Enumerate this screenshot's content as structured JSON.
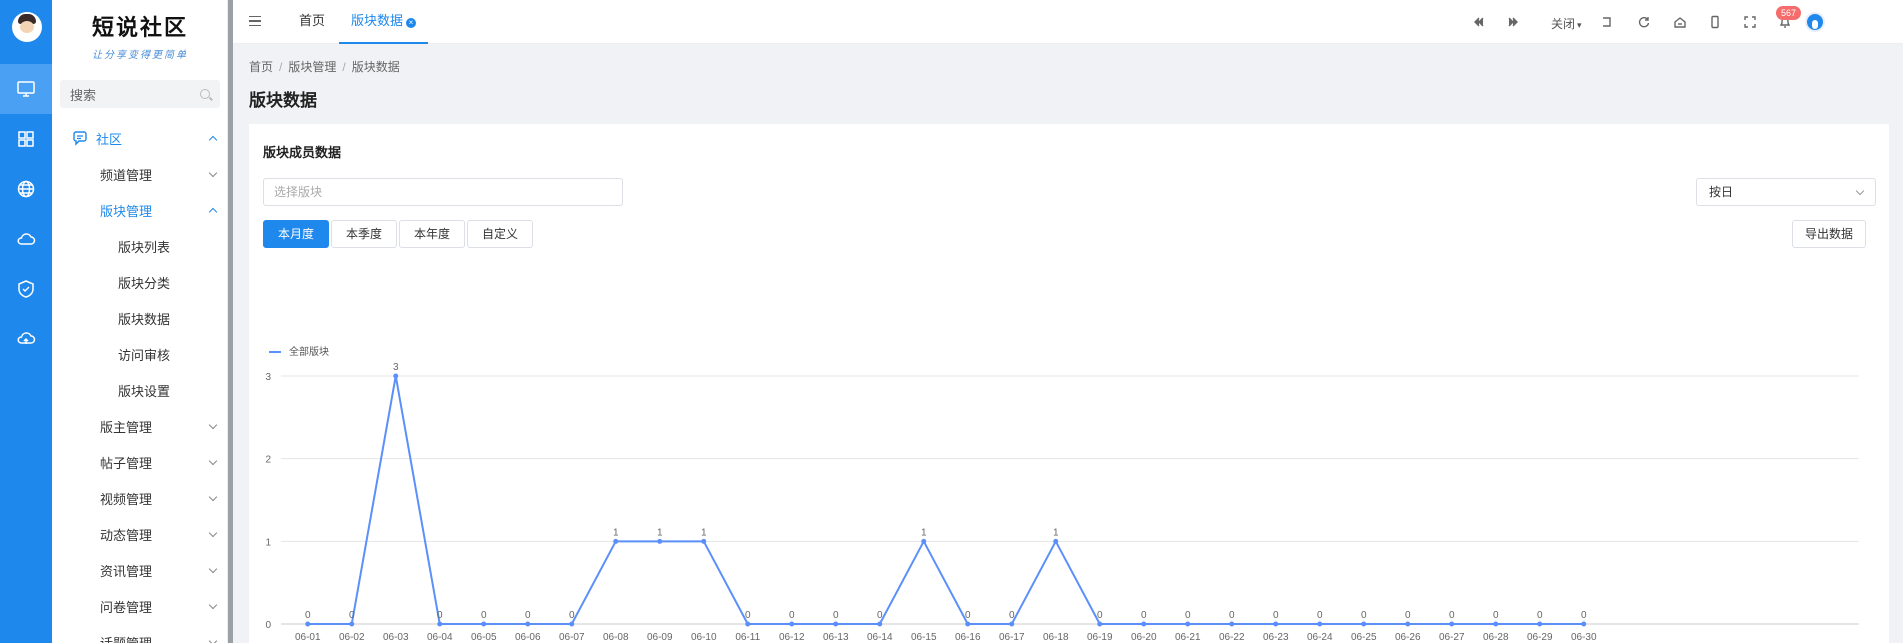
{
  "sidebar": {
    "logo_title": "短说社区",
    "logo_sub": "让分享变得更简单",
    "search_label": "搜索",
    "rail_icons": [
      "monitor-icon",
      "grid-icon",
      "globe-icon",
      "cloud-icon",
      "shield-icon",
      "cloud-home-icon"
    ],
    "menu": [
      {
        "label": "社区",
        "level": 1,
        "expanded": true
      },
      {
        "label": "频道管理",
        "level": 2
      },
      {
        "label": "版块管理",
        "level": 2,
        "expanded": true
      },
      {
        "label": "版块列表",
        "level": 3
      },
      {
        "label": "版块分类",
        "level": 3
      },
      {
        "label": "版块数据",
        "level": 3
      },
      {
        "label": "访问审核",
        "level": 3
      },
      {
        "label": "版块设置",
        "level": 3
      },
      {
        "label": "版主管理",
        "level": 2
      },
      {
        "label": "帖子管理",
        "level": 2
      },
      {
        "label": "视频管理",
        "level": 2
      },
      {
        "label": "动态管理",
        "level": 2
      },
      {
        "label": "资讯管理",
        "level": 2
      },
      {
        "label": "问卷管理",
        "level": 2
      },
      {
        "label": "话题管理",
        "level": 2
      }
    ]
  },
  "topbar": {
    "tabs": [
      {
        "label": "首页",
        "active": false
      },
      {
        "label": "版块数据",
        "active": true
      }
    ],
    "close_menu_label": "关闭",
    "notification_count": "567",
    "accent": "#1e88ec"
  },
  "breadcrumb": [
    "首页",
    "版块管理",
    "版块数据"
  ],
  "page_title": "版块数据",
  "card": {
    "title": "版块成员数据",
    "select_placeholder": "选择版块",
    "period_select": "按日",
    "range_buttons": [
      "本月度",
      "本季度",
      "本年度",
      "自定义"
    ],
    "active_range": "本月度",
    "export_label": "导出数据"
  },
  "chart_data": {
    "type": "line",
    "x": [
      "06-01",
      "06-02",
      "06-03",
      "06-04",
      "06-05",
      "06-06",
      "06-07",
      "06-08",
      "06-09",
      "06-10",
      "06-11",
      "06-12",
      "06-13",
      "06-14",
      "06-15",
      "06-16",
      "06-17",
      "06-18",
      "06-19",
      "06-20",
      "06-21",
      "06-22",
      "06-23",
      "06-24",
      "06-25",
      "06-26",
      "06-27",
      "06-28",
      "06-29",
      "06-30"
    ],
    "series": [
      {
        "name": "全部版块",
        "values": [
          0,
          0,
          3,
          0,
          0,
          0,
          0,
          1,
          1,
          1,
          0,
          0,
          0,
          0,
          1,
          0,
          0,
          1,
          0,
          0,
          0,
          0,
          0,
          0,
          0,
          0,
          0,
          0,
          0,
          0
        ],
        "color": "#5b8ff9"
      }
    ],
    "ylim": [
      0,
      3
    ],
    "yticks": [
      0,
      1,
      2,
      3
    ],
    "grid": true,
    "legend_position": "top-left",
    "data_labels": true
  }
}
